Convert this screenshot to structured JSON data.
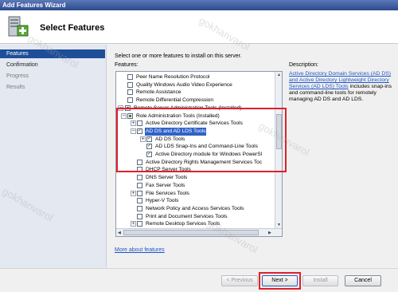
{
  "window": {
    "title": "Add Features Wizard"
  },
  "header": {
    "title": "Select Features"
  },
  "sidebar": {
    "items": [
      {
        "label": "Features",
        "state": "active"
      },
      {
        "label": "Confirmation",
        "state": "normal"
      },
      {
        "label": "Progress",
        "state": "disabled"
      },
      {
        "label": "Results",
        "state": "disabled"
      }
    ]
  },
  "main": {
    "instruction": "Select one or more features to install on this server.",
    "features_label": "Features:",
    "description_label": "Description:",
    "description_link": "Active Directory Domain Services (AD DS) and Active Directory Lightweight Directory Services (AD LDS) Tools",
    "description_text": "includes snap-ins and command-line tools for remotely managing AD DS and AD LDS.",
    "more_link": "More about features"
  },
  "tree": [
    {
      "label": "Peer Name Resolution Protocol",
      "checked": "none"
    },
    {
      "label": "Quality Windows Audio Video Experience",
      "checked": "none"
    },
    {
      "label": "Remote Assistance",
      "checked": "none"
    },
    {
      "label": "Remote Differential Compression",
      "checked": "none"
    },
    {
      "label": "Remote Server Administration Tools  (Installed)",
      "checked": "partial",
      "expander": "-"
    },
    {
      "label": "Role Administration Tools  (Installed)",
      "checked": "partial",
      "expander": "-"
    },
    {
      "label": "Active Directory Certificate Services Tools",
      "checked": "none",
      "expander": "+"
    },
    {
      "label": "AD DS and AD LDS Tools",
      "checked": "checked",
      "expander": "-",
      "selected": true
    },
    {
      "label": "AD DS Tools",
      "checked": "checked",
      "expander": "+"
    },
    {
      "label": "AD LDS Snap-Ins and Command-Line Tools",
      "checked": "checked"
    },
    {
      "label": "Active Directory module for Windows PowerSl",
      "checked": "checked"
    },
    {
      "label": "Active Directory Rights Management Services Toc",
      "checked": "none"
    },
    {
      "label": "DHCP Server Tools",
      "checked": "none"
    },
    {
      "label": "DNS Server Tools",
      "checked": "none"
    },
    {
      "label": "Fax Server Tools",
      "checked": "none"
    },
    {
      "label": "File Services Tools",
      "checked": "none",
      "expander": "+"
    },
    {
      "label": "Hyper-V Tools",
      "checked": "none"
    },
    {
      "label": "Network Policy and Access Services Tools",
      "checked": "none"
    },
    {
      "label": "Print and Document Services Tools",
      "checked": "none"
    },
    {
      "label": "Remote Desktop Services Tools",
      "checked": "none",
      "expander": "+"
    }
  ],
  "buttons": {
    "previous": "< Previous",
    "next": "Next >",
    "install": "Install",
    "cancel": "Cancel"
  },
  "watermark": "gokhanvarol",
  "colors": {
    "highlight": "#e0202a",
    "selection": "#3062c8",
    "link": "#1f56c7",
    "nav_active": "#1f4e99"
  }
}
